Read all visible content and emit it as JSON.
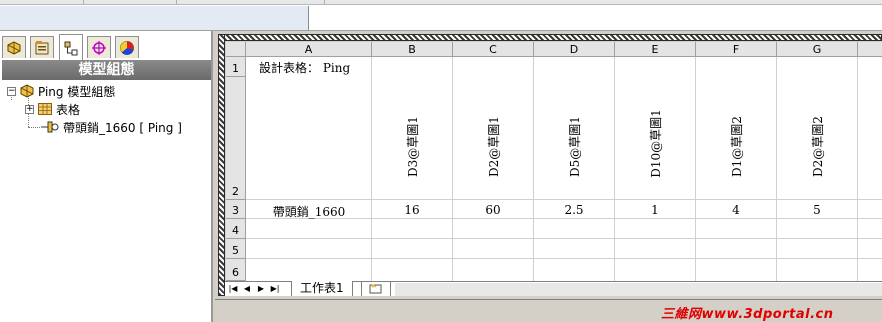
{
  "feature_manager": {
    "tabs": [
      {
        "icon": "part-feature-icon",
        "active": false
      },
      {
        "icon": "property-manager-icon",
        "active": false
      },
      {
        "icon": "configuration-manager-icon",
        "active": true
      },
      {
        "icon": "dimxpert-icon",
        "active": false
      },
      {
        "icon": "display-manager-icon",
        "active": false
      }
    ],
    "title": "模型組態",
    "tree": {
      "root_label": "Ping 模型組態",
      "table_label": "表格",
      "config_label": "帶頭銷_1660 [ Ping ]"
    }
  },
  "spreadsheet": {
    "columns": [
      "A",
      "B",
      "C",
      "D",
      "E",
      "F",
      "G"
    ],
    "rows": [
      "1",
      "2",
      "3",
      "4",
      "5",
      "6"
    ],
    "title_cell": "設計表格： Ping",
    "parameter_headers": [
      "D3@草圖1",
      "D2@草圖1",
      "D5@草圖1",
      "D10@草圖1",
      "D1@草圖2",
      "D2@草圖2"
    ],
    "config_name": "帶頭銷_1660",
    "values": [
      "16",
      "60",
      "2.5",
      "1",
      "4",
      "5"
    ],
    "sheet_tab": "工作表1",
    "nav_buttons": [
      "first",
      "prev",
      "next",
      "last"
    ]
  },
  "watermark": "三維网www.3dportal.cn",
  "colors": {
    "panel_title_bg": "#7a7a7a",
    "header_bg": "#e4e4e4",
    "watermark": "#e00000"
  }
}
